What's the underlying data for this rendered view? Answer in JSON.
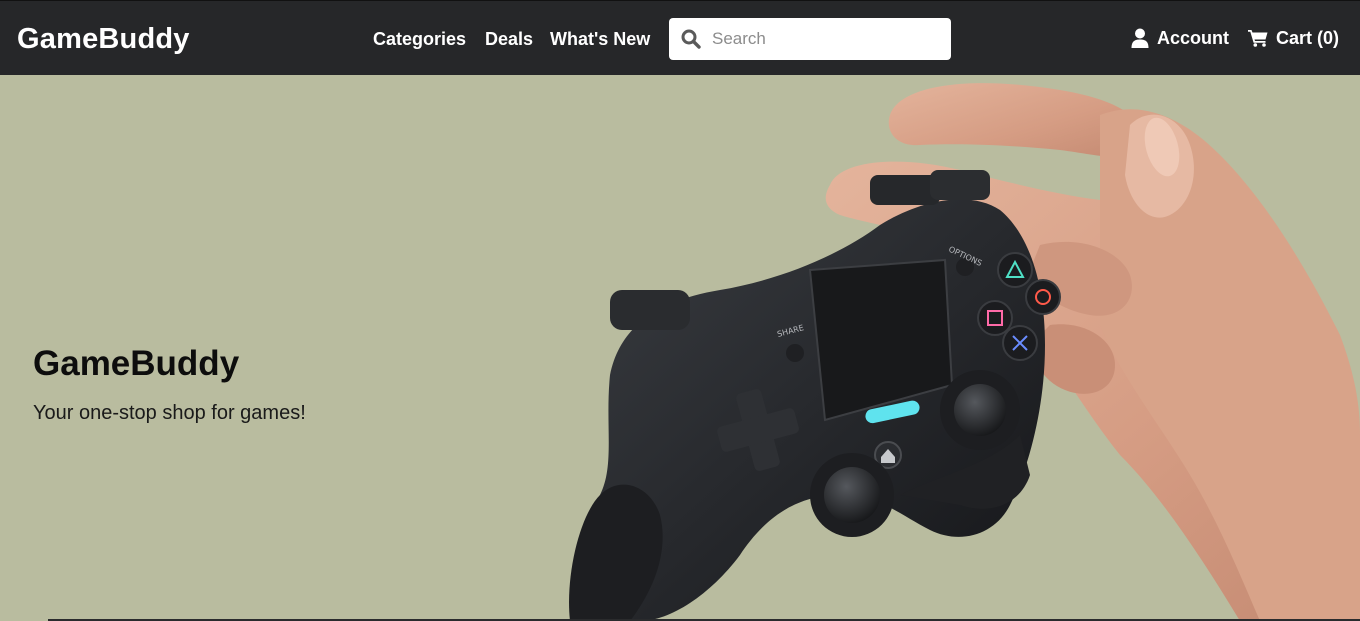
{
  "header": {
    "brand": "GameBuddy",
    "nav_links": [
      "Categories",
      "Deals",
      "What's New"
    ],
    "search": {
      "placeholder": "Search",
      "value": ""
    },
    "account_label": "Account",
    "cart_label": "Cart (0)"
  },
  "hero": {
    "title": "GameBuddy",
    "subtitle": "Your one-stop shop for games!",
    "controller_labels": {
      "share": "SHARE",
      "options": "OPTIONS"
    }
  },
  "colors": {
    "navbar_bg": "#262729",
    "hero_bg": "#b9bc9f",
    "light_bar": "#5fe3ee"
  },
  "icons": [
    "search-icon",
    "user-icon",
    "cart-icon",
    "home-icon"
  ]
}
